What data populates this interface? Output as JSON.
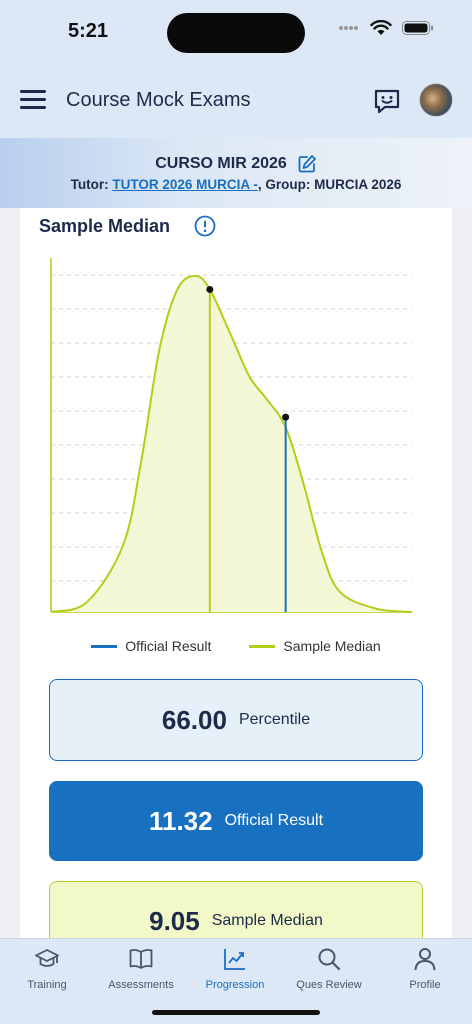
{
  "status_bar": {
    "time": "5:21"
  },
  "header": {
    "title": "Course Mock Exams"
  },
  "course": {
    "name": "CURSO MIR 2026",
    "tutor_label": "Tutor:",
    "tutor_name": "TUTOR 2026 MURCIA -",
    "group_text": ", Group: MURCIA 2026"
  },
  "section": {
    "title": "Sample Median"
  },
  "chart_data": {
    "type": "area",
    "title": "",
    "xlabel": "",
    "ylabel": "",
    "grid": "horizontal dashed",
    "legend_placement": "bottom",
    "colors": {
      "official": "#1770c0",
      "sample": "#b5cc18"
    },
    "series": [
      {
        "name": "Official Result",
        "value": 11.32,
        "marker_height_fraction": 0.58
      },
      {
        "name": "Sample Median",
        "value": 9.05,
        "marker_height_fraction": 0.96
      }
    ],
    "distribution_curve": {
      "x_fraction": [
        0,
        0.1,
        0.2,
        0.25,
        0.3,
        0.35,
        0.4,
        0.44,
        0.5,
        0.55,
        0.6,
        0.65,
        0.7,
        0.75,
        0.8,
        0.9,
        1
      ],
      "y_fraction": [
        0,
        0.03,
        0.2,
        0.45,
        0.78,
        0.96,
        1.0,
        0.96,
        0.82,
        0.7,
        0.63,
        0.55,
        0.38,
        0.18,
        0.06,
        0.01,
        0
      ]
    }
  },
  "legend": {
    "official_label": "Official Result",
    "sample_label": "Sample Median"
  },
  "stats": {
    "percentile_value": "66.00",
    "percentile_label": "Percentile",
    "official_value": "11.32",
    "official_label": "Official Result",
    "sample_value": "9.05",
    "sample_label": "Sample Median"
  },
  "tabs": [
    {
      "label": "Training",
      "icon": "graduation-cap-icon"
    },
    {
      "label": "Assessments",
      "icon": "book-icon"
    },
    {
      "label": "Progression",
      "icon": "chart-icon",
      "active": true
    },
    {
      "label": "Ques Review",
      "icon": "search-icon"
    },
    {
      "label": "Profile",
      "icon": "user-icon"
    }
  ]
}
